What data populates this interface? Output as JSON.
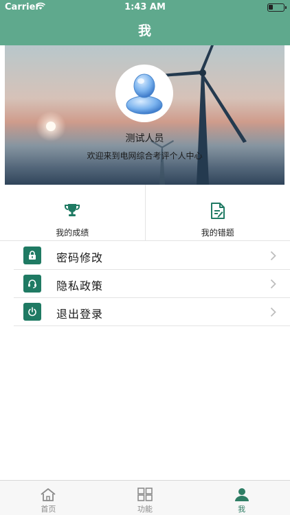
{
  "status_bar": {
    "carrier": "Carrier",
    "time": "1:43 AM"
  },
  "nav": {
    "title": "我"
  },
  "profile": {
    "name": "测试人员",
    "welcome": "欢迎来到电网综合考评个人中心"
  },
  "shortcuts": [
    {
      "label": "我的成绩",
      "icon": "trophy-icon"
    },
    {
      "label": "我的错题",
      "icon": "document-edit-icon"
    }
  ],
  "menu": [
    {
      "label": "密码修改",
      "icon": "lock-icon"
    },
    {
      "label": "隐私政策",
      "icon": "headset-icon"
    },
    {
      "label": "退出登录",
      "icon": "power-icon"
    }
  ],
  "tabbar": {
    "items": [
      {
        "label": "首页",
        "icon": "home-icon",
        "active": false
      },
      {
        "label": "功能",
        "icon": "grid-icon",
        "active": false
      },
      {
        "label": "我",
        "icon": "person-icon",
        "active": true
      }
    ]
  },
  "colors": {
    "header": "#5fa98d",
    "accent": "#1f7a63",
    "tab_active": "#2e7d64"
  }
}
